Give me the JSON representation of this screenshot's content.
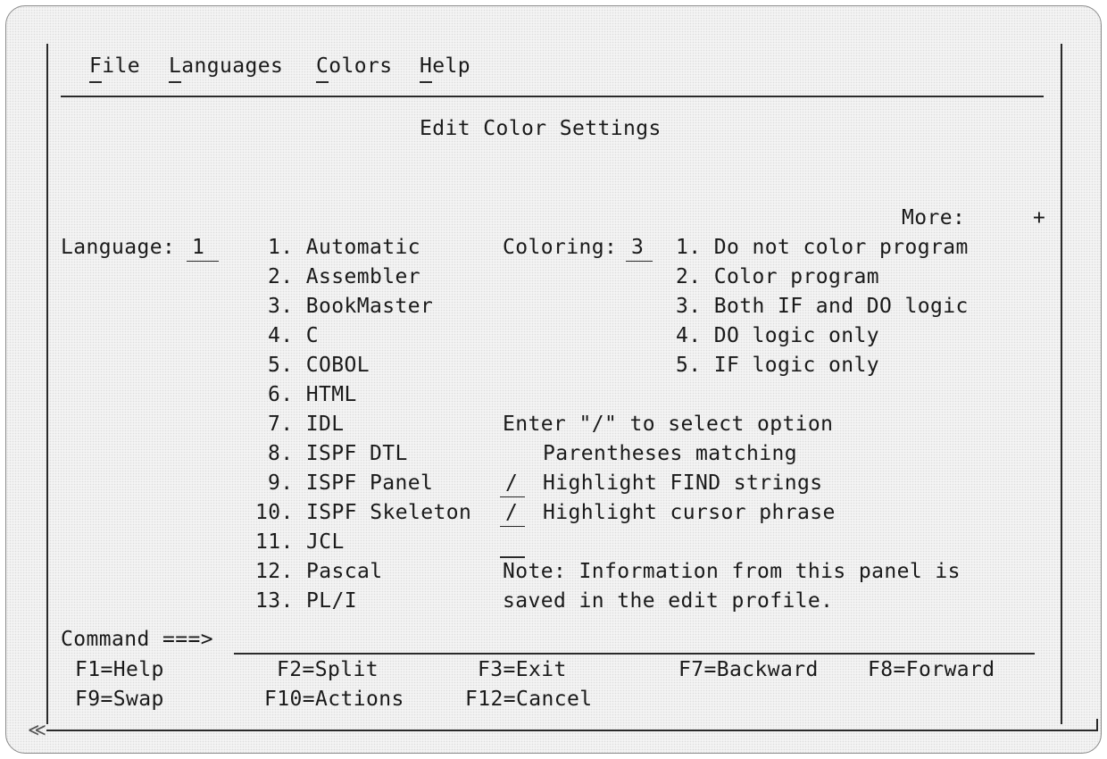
{
  "menu": [
    {
      "label": "File"
    },
    {
      "label": "Languages"
    },
    {
      "label": "Colors"
    },
    {
      "label": "Help"
    }
  ],
  "title": "Edit Color Settings",
  "more_label": "More:",
  "more_indicator": "+",
  "language": {
    "label": "Language:",
    "value": "1",
    "options": [
      "1. Automatic",
      "2. Assembler",
      "3. BookMaster",
      "4. C",
      "5. COBOL",
      "6. HTML",
      "7. IDL",
      "8. ISPF DTL",
      "9. ISPF Panel",
      "10. ISPF Skeleton",
      "11. JCL",
      "12. Pascal",
      "13. PL/I"
    ]
  },
  "coloring": {
    "label": "Coloring:",
    "value": "3",
    "options": [
      "1. Do not color program",
      "2. Color program",
      "3. Both IF and DO logic",
      "4. DO logic only",
      "5. IF logic only"
    ]
  },
  "select_prompt": "Enter \"/\" to select option",
  "checkboxes": [
    {
      "mark": "",
      "label": "Parentheses matching"
    },
    {
      "mark": "/",
      "label": "Highlight FIND strings"
    },
    {
      "mark": "/",
      "label": "Highlight cursor phrase"
    }
  ],
  "note": [
    "Note: Information from this panel is",
    "saved in the edit profile."
  ],
  "command_label": "Command ===>",
  "command_value": "",
  "function_keys": [
    {
      "label": "F1=Help"
    },
    {
      "label": "F2=Split"
    },
    {
      "label": "F3=Exit"
    },
    {
      "label": "F7=Backward"
    },
    {
      "label": "F8=Forward"
    },
    {
      "label": "F9=Swap"
    },
    {
      "label": "F10=Actions"
    },
    {
      "label": "F12=Cancel"
    }
  ],
  "scroll_arrow": "≪"
}
